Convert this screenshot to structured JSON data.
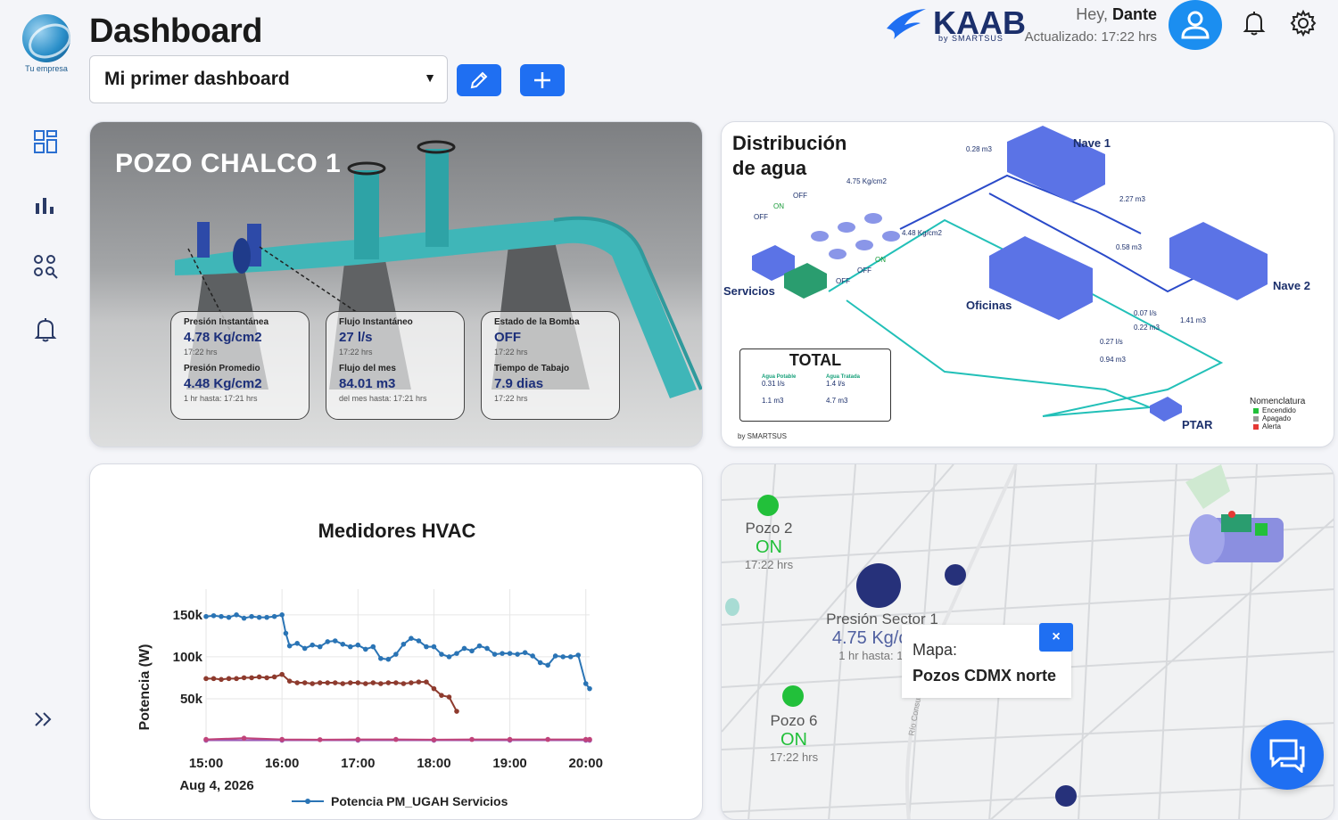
{
  "header": {
    "logo_text": "Tu empresa",
    "title": "Dashboard",
    "dashboard_select": "Mi primer dashboard",
    "brand_name": "KAAB",
    "brand_sub": "by SMARTSUS",
    "greeting": "Hey,",
    "user_name": "Dante",
    "updated": "Actualizado: 17:22 hrs"
  },
  "icons": {
    "edit": "pencil-icon",
    "add": "plus-icon",
    "user": "user-icon",
    "bell": "bell-icon",
    "gear": "gear-icon",
    "side": [
      "grid-icon",
      "bar-chart-icon",
      "search-shapes-icon",
      "bell-icon",
      "double-chevron-icon"
    ]
  },
  "pozo": {
    "title": "POZO CHALCO 1",
    "metrics": [
      {
        "label": "Presión Instantánea",
        "value": "4.78 Kg/cm2",
        "sub": "17:22 hrs",
        "label2": "Presión Promedio",
        "value2": "4.48 Kg/cm2",
        "sub2": "1 hr hasta: 17:21 hrs"
      },
      {
        "label": "Flujo Instantáneo",
        "value": "27 l/s",
        "sub": "17:22 hrs",
        "label2": "Flujo del mes",
        "value2": "84.01 m3",
        "sub2": "del mes hasta: 17:21 hrs"
      },
      {
        "label": "Estado de la Bomba",
        "value": "OFF",
        "sub": "17:22 hrs",
        "label2": "Tiempo de Tabajo",
        "value2": "7.9 dias",
        "sub2": "17:22 hrs"
      }
    ]
  },
  "distribucion": {
    "title_line1": "Distribución",
    "title_line2": "de agua",
    "nave1": "Nave 1",
    "nave2": "Nave 2",
    "oficinas": "Oficinas",
    "servicios": "Servicios",
    "ptar": "PTAR",
    "readings": [
      "0.28 m3",
      "4.75 Kg/cm2",
      "2.27 m3",
      "4.48 Kg/cm2",
      "0.58 m3",
      "0.07 l/s",
      "0.22 m3",
      "1.41 m3",
      "0.27 l/s",
      "0.94 m3"
    ],
    "states": [
      "OFF",
      "ON",
      "OFF",
      "ON",
      "OFF",
      "OFF"
    ],
    "total_title": "TOTAL",
    "total_potable_label": "Agua Potable",
    "total_tratada_label": "Agua Tratada",
    "total_potable": [
      "0.31 l/s",
      "1.1 m3"
    ],
    "total_tratada": [
      "1.4 l/s",
      "4.7 m3"
    ],
    "footer": "by SMARTSUS",
    "nomenclatura": "Nomenclatura",
    "legend": [
      {
        "label": "Encendido",
        "color": "#22c03a"
      },
      {
        "label": "Apagado",
        "color": "#999999"
      },
      {
        "label": "Alerta",
        "color": "#e53935"
      }
    ]
  },
  "hvac": {
    "title": "Medidores HVAC",
    "date_label": "Aug 4, 2026",
    "legend_item": "Potencia PM_UGAH Servicios"
  },
  "chart_data": {
    "type": "line",
    "title": "Medidores HVAC",
    "xlabel": "",
    "ylabel": "Potencia (W)",
    "x_ticks": [
      "15:00",
      "16:00",
      "17:00",
      "18:00",
      "19:00",
      "20:00"
    ],
    "y_ticks": [
      "50k",
      "100k",
      "150k"
    ],
    "xlim_hours": [
      15.0,
      20.05
    ],
    "ylim": [
      0,
      170000
    ],
    "series": [
      {
        "name": "Potencia PM_UGAH Servicios",
        "color": "#2a74b5",
        "x": [
          15.0,
          15.1,
          15.2,
          15.3,
          15.4,
          15.5,
          15.6,
          15.7,
          15.8,
          15.9,
          16.0,
          16.05,
          16.1,
          16.2,
          16.3,
          16.4,
          16.5,
          16.6,
          16.7,
          16.8,
          16.9,
          17.0,
          17.1,
          17.2,
          17.3,
          17.4,
          17.5,
          17.6,
          17.7,
          17.8,
          17.9,
          18.0,
          18.1,
          18.2,
          18.3,
          18.4,
          18.5,
          18.6,
          18.7,
          18.8,
          18.9,
          19.0,
          19.1,
          19.2,
          19.3,
          19.4,
          19.5,
          19.6,
          19.7,
          19.8,
          19.9,
          20.0,
          20.05
        ],
        "y": [
          148000,
          149000,
          148000,
          147000,
          150000,
          146000,
          148000,
          147000,
          147000,
          148000,
          150000,
          128000,
          113000,
          116000,
          110000,
          114000,
          112000,
          118000,
          119000,
          115000,
          112000,
          114000,
          109000,
          112000,
          98000,
          97000,
          103000,
          115000,
          122000,
          119000,
          112000,
          112000,
          103000,
          100000,
          104000,
          110000,
          107000,
          113000,
          110000,
          103000,
          104000,
          104000,
          103000,
          105000,
          101000,
          93000,
          90000,
          101000,
          100000,
          100000,
          102000,
          68000,
          62000
        ]
      },
      {
        "color": "#8e3b2e",
        "x": [
          15.0,
          15.1,
          15.2,
          15.3,
          15.4,
          15.5,
          15.6,
          15.7,
          15.8,
          15.9,
          16.0,
          16.1,
          16.2,
          16.3,
          16.4,
          16.5,
          16.6,
          16.7,
          16.8,
          16.9,
          17.0,
          17.1,
          17.2,
          17.3,
          17.4,
          17.5,
          17.6,
          17.7,
          17.8,
          17.9,
          18.0,
          18.1,
          18.2,
          18.3
        ],
        "y": [
          74000,
          74000,
          73000,
          74000,
          74000,
          75000,
          75000,
          76000,
          75000,
          76000,
          79000,
          71000,
          69000,
          69000,
          68000,
          69000,
          69000,
          69000,
          68000,
          69000,
          69000,
          68000,
          69000,
          68000,
          69000,
          69000,
          68000,
          69000,
          70000,
          70000,
          62000,
          54000,
          52000,
          35000
        ]
      },
      {
        "color": "#c0437a",
        "x": [
          15.0,
          15.5,
          16.0,
          16.5,
          17.0,
          17.5,
          18.0,
          18.5,
          19.0,
          19.5,
          20.0,
          20.05
        ],
        "y": [
          1500,
          3000,
          1500,
          1200,
          1500,
          1500,
          1200,
          1500,
          1500,
          1500,
          1500,
          1500
        ]
      },
      {
        "color": "#9b59b6",
        "x": [
          15.0,
          16.0,
          17.0,
          18.0,
          19.0,
          20.0,
          20.05
        ],
        "y": [
          500,
          500,
          500,
          500,
          500,
          500,
          500
        ]
      }
    ]
  },
  "map": {
    "popup_label": "Mapa:",
    "popup_name": "Pozos CDMX norte",
    "close": "×",
    "markers": [
      {
        "name": "Pozo 2",
        "state": "ON",
        "time": "17:22 hrs"
      },
      {
        "name": "Presión Sector 1",
        "value": "4.75 Kg/cm2",
        "time": "1 hr hasta: 17:21"
      },
      {
        "name": "Pozo 6",
        "state": "ON",
        "time": "17:22 hrs"
      }
    ],
    "street": "Río Consulado"
  }
}
